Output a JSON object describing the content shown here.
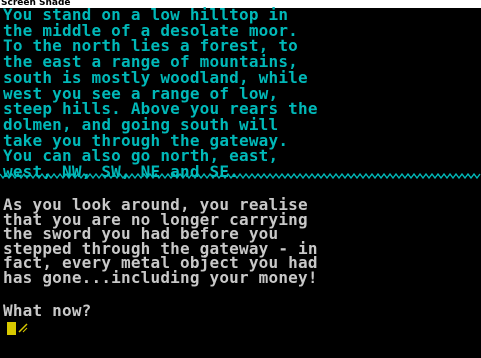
{
  "window": {
    "title": "Screen Shade"
  },
  "location": {
    "description": "You stand on a low hilltop in\nthe middle of a desolate moor.\nTo the north lies a forest, to\nthe east a range of mountains,\nsouth is mostly woodland, while\nwest you see a range of low,\nsteep hills. Above you rears the\ndolmen, and going south will\ntake you through the gateway.\nYou can also go north, east,\nwest, NW, SW, NE and SE."
  },
  "narration": {
    "text": "As you look around, you realise\nthat you are no longer carrying\nthe sword you had before you\nstepped through the gateway - in\nfact, every metal object you had\nhas gone...including your money!"
  },
  "prompt": {
    "label": "What now?"
  },
  "colors": {
    "description_text": "#00b8b8",
    "narration_text": "#c8c8c8",
    "divider": "#00b8b8",
    "cursor": "#d8c800",
    "background": "#000000",
    "title_strip": "#ffffff"
  },
  "icons": {
    "cursor": "blinking-block-cursor-icon"
  }
}
